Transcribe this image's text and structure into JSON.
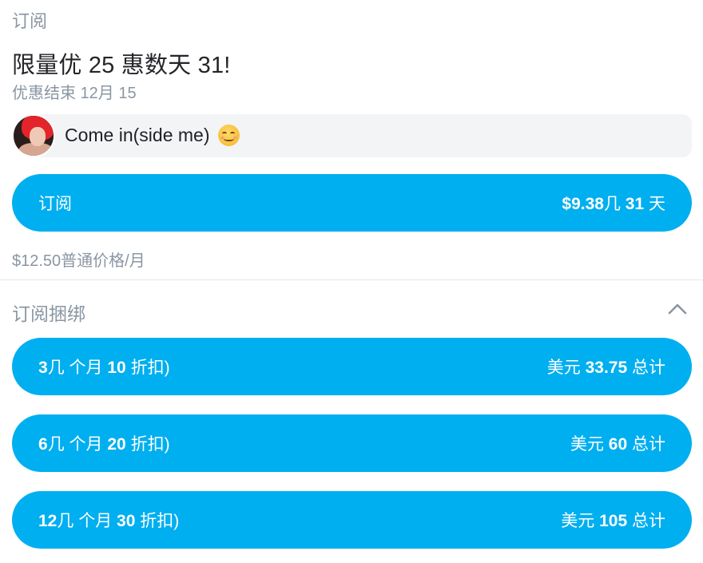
{
  "subscribe_section": {
    "label": "订阅",
    "promo_title": "限量优 25 惠数天 31!",
    "promo_sub": "优惠结束 12月 15",
    "message": "Come in(side me)",
    "message_emoji": "smiling-face-with-smiling-eyes",
    "subscribe_button": {
      "label": "订阅",
      "price": "$9.38",
      "duration_prefix": "几",
      "duration_num": "31",
      "duration_unit": "天"
    },
    "regular_price": "$12.50普通价格/月"
  },
  "bundles": {
    "title": "订阅捆绑",
    "items": [
      {
        "months": "3",
        "mid": "几 个月",
        "discount": "10",
        "suffix": "折扣)",
        "currency": "美元",
        "total": "33.75",
        "total_label": "总计"
      },
      {
        "months": "6",
        "mid": "几 个月",
        "discount": "20",
        "suffix": "折扣)",
        "currency": "美元",
        "total": "60",
        "total_label": "总计"
      },
      {
        "months": "12",
        "mid": "几 个月",
        "discount": "30",
        "suffix": "折扣)",
        "currency": "美元",
        "total": "105",
        "total_label": "总计"
      }
    ]
  },
  "colors": {
    "accent": "#00aff0",
    "muted_text": "#8a96a3",
    "bubble_bg": "#f3f4f6"
  }
}
